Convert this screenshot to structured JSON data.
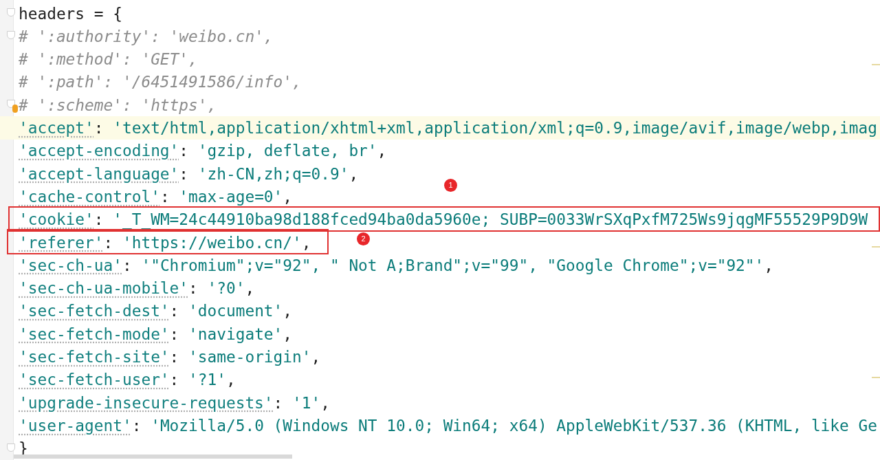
{
  "lines": [
    {
      "kind": "code",
      "text": "headers = {",
      "fold": true
    },
    {
      "kind": "comment",
      "text": "# ':authority': 'weibo.cn',",
      "fold": true
    },
    {
      "kind": "comment",
      "text": "# ':method': 'GET',"
    },
    {
      "kind": "comment",
      "text": "# ':path': '/6451491586/info',"
    },
    {
      "kind": "comment",
      "text": "# ':scheme': 'https',",
      "fold": true,
      "bulb": true
    },
    {
      "kind": "pair",
      "key": "'accept'",
      "sep": ": ",
      "value": "'text/html,application/xhtml+xml,application/xml;q=0.9,image/avif,image/webp,imag",
      "current": true
    },
    {
      "kind": "pair",
      "key": "'accept-encoding'",
      "sep": ": ",
      "value": "'gzip, deflate, br'",
      "end": ","
    },
    {
      "kind": "pair",
      "key": "'accept-language'",
      "sep": ": ",
      "value": "'zh-CN,zh;q=0.9'",
      "end": ","
    },
    {
      "kind": "pair",
      "key": "'cache-control'",
      "sep": ": ",
      "value": "'max-age=0'",
      "end": ","
    },
    {
      "kind": "pair",
      "key": "'cookie'",
      "sep": ": ",
      "value": "'_T_WM=24c44910ba98d188fced94ba0da5960e; SUBP=0033WrSXqPxfM725Ws9jqgMF55529P9D9W",
      "box": {
        "badge": "1",
        "wide": true
      }
    },
    {
      "kind": "pair",
      "key": "'referer'",
      "sep": ": ",
      "value": "'https://weibo.cn/'",
      "end": ",",
      "box": {
        "badge": "2",
        "wide": false
      }
    },
    {
      "kind": "pair",
      "key": "'sec-ch-ua'",
      "sep": ": ",
      "value": "'\"Chromium\";v=\"92\", \" Not A;Brand\";v=\"99\", \"Google Chrome\";v=\"92\"'",
      "end": ","
    },
    {
      "kind": "pair",
      "key": "'sec-ch-ua-mobile'",
      "sep": ": ",
      "value": "'?0'",
      "end": ","
    },
    {
      "kind": "pair",
      "key": "'sec-fetch-dest'",
      "sep": ": ",
      "value": "'document'",
      "end": ","
    },
    {
      "kind": "pair",
      "key": "'sec-fetch-mode'",
      "sep": ": ",
      "value": "'navigate'",
      "end": ","
    },
    {
      "kind": "pair",
      "key": "'sec-fetch-site'",
      "sep": ": ",
      "value": "'same-origin'",
      "end": ","
    },
    {
      "kind": "pair",
      "key": "'sec-fetch-user'",
      "sep": ": ",
      "value": "'?1'",
      "end": ","
    },
    {
      "kind": "pair",
      "key": "'upgrade-insecure-requests'",
      "sep": ": ",
      "value": "'1'",
      "end": ","
    },
    {
      "kind": "pair",
      "key": "'user-agent'",
      "sep": ": ",
      "value": "'Mozilla/5.0 (Windows NT 10.0; Win64; x64) AppleWebKit/537.36 (KHTML, like Ge"
    },
    {
      "kind": "code",
      "text": "}",
      "fold": true
    }
  ]
}
